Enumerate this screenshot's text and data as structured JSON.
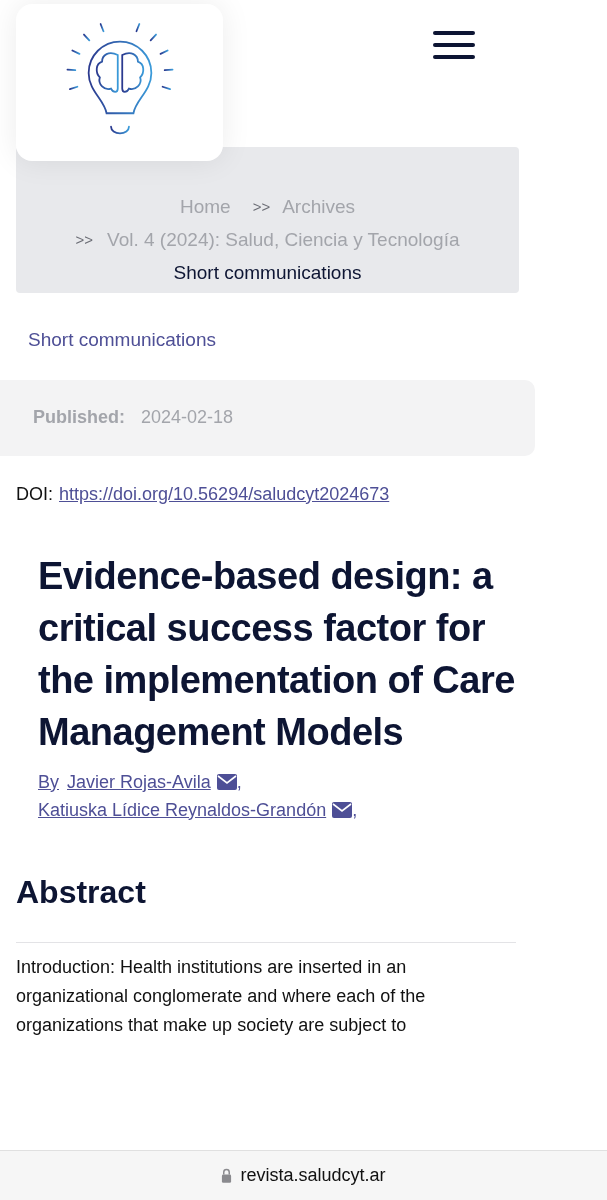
{
  "breadcrumb": {
    "items": [
      "Home",
      "Archives",
      "Vol. 4 (2024): Salud, Ciencia y Tecnología"
    ],
    "separator": ">>",
    "current": "Short communications"
  },
  "section_link": "Short communications",
  "published": {
    "label": "Published:",
    "value": "2024-02-18"
  },
  "doi": {
    "label": "DOI:",
    "link": "https://doi.org/10.56294/saludcyt2024673"
  },
  "title": "Evidence-based design: a critical success factor for the implementation of Care Management Models",
  "byline": {
    "prefix": "By",
    "authors": [
      {
        "name": "Javier Rojas-Avila"
      },
      {
        "name": "Katiuska Lídice Reynaldos-Grandón"
      }
    ],
    "separator": ","
  },
  "abstract": {
    "heading": "Abstract",
    "text": "Introduction: Health institutions are inserted in an organizational conglomerate and where each of the organizations that make up society are subject to"
  },
  "address_bar": {
    "url": "revista.saludcyt.ar"
  }
}
